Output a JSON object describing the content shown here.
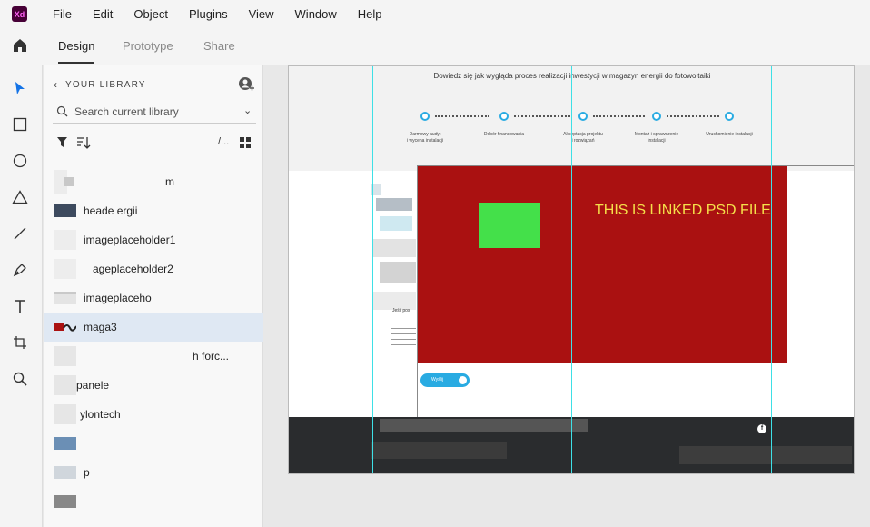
{
  "app": {
    "logo_text": "Xd"
  },
  "menu": [
    "File",
    "Edit",
    "Object",
    "Plugins",
    "View",
    "Window",
    "Help"
  ],
  "tabs": {
    "design": "Design",
    "prototype": "Prototype",
    "share": "Share"
  },
  "library": {
    "title": "YOUR LIBRARY",
    "search_placeholder": "Search current library",
    "list_view_label": "/..."
  },
  "assets": [
    {
      "label": "m",
      "selected": false
    },
    {
      "label": "heade           ergii",
      "selected": false
    },
    {
      "label": "imageplaceholder1",
      "selected": false
    },
    {
      "label": "ageplaceholder2",
      "selected": false
    },
    {
      "label": "imageplaceho",
      "selected": false
    },
    {
      "label": "maga3",
      "selected": true
    },
    {
      "label": "h forc...",
      "selected": false
    },
    {
      "label": "panele",
      "selected": false
    },
    {
      "label": "ylontech",
      "selected": false
    },
    {
      "label": "",
      "selected": false
    },
    {
      "label": "p",
      "selected": false
    },
    {
      "label": "",
      "selected": false
    }
  ],
  "artboard": {
    "heading": "Dowiedz się jak wygląda proces realizacji inwestycji w magazyn energii do fotowoltaiki",
    "steps": [
      "Darmowy audyt\ni wycena instalacji",
      "Dobór finansowania",
      "Akceptacja projektu\ni rozwiązań",
      "Montaż i sprawdzenie\ninstalacji",
      "Uruchomienie instalacji"
    ],
    "psd_text": "THIS IS LINKED PSD FILE",
    "send_button": "Wyślij",
    "fb_icon": "f",
    "form_text": "Jeśli pos"
  },
  "colors": {
    "accent": "#29abe2",
    "psd_red": "#aa1111",
    "psd_text": "#f5e04a",
    "green": "#44e04a",
    "guide": "#3ee0e6"
  }
}
